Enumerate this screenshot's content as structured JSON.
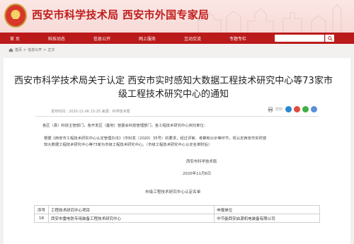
{
  "header": {
    "site_title": "西安市科学技术局  西安市外国专家局"
  },
  "nav": {
    "items": [
      "首  页",
      "科技动态",
      "信息公开",
      "网上服务",
      "互动交流",
      "专题专栏"
    ]
  },
  "breadcrumb": {
    "items": [
      "首页",
      ">",
      "信息公开",
      ">",
      "正文"
    ]
  },
  "article": {
    "title_line1": "西安市科学技术局关于认定 西安市实时感知大数据工程技术研究中心等73家市",
    "title_line2": "级工程技术研究中心的通知",
    "meta": "发布时间：2020-11-06 15:25    来源：科学技术局",
    "share_label": "打印",
    "greeting": "各区（县）科技主管部门，各开发区（基地）管委会科技管理部门，各工程技术研究中心依托单位：",
    "main_line1": "根据《西安市工程技术研究中心认定管理办法》（市科发〔2020〕35号）的要求，经过评审、考察和公示等环节，现认定西安市实时感",
    "main_line2": "知大数据工程技术研究中心等73家为市级工程技术研究中心。（市级工程技术研究中心认定名单附后）",
    "signature_org": "西安市科学技术局",
    "signature_date": "2020年11月6日",
    "list_title": "市级工程技术研究中心认定名单"
  },
  "table": {
    "headers": [
      "序号",
      "工程技术研究中心项目",
      "申报单位"
    ],
    "rows": [
      [
        "18",
        "西安市雷电防专用装备工程技术研究中心",
        "中节能西安启源机电装备有限公司"
      ]
    ]
  }
}
